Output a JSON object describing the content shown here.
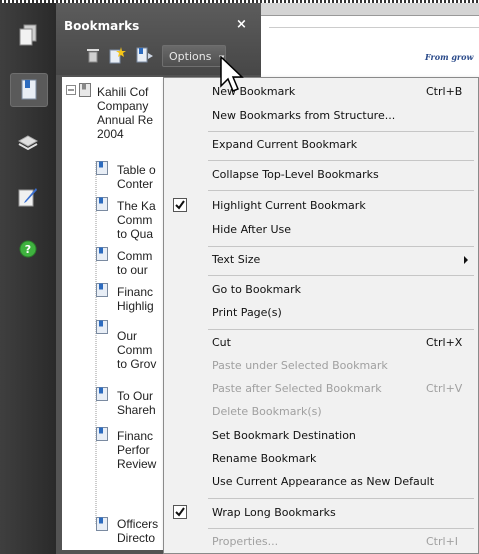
{
  "panel": {
    "title": "Bookmarks",
    "close": "×",
    "options_label": "Options"
  },
  "doc": {
    "header_text": "From grow"
  },
  "tree": {
    "items": [
      "Kahili Cof",
      "Company",
      "Annual Re",
      "2004",
      "Table o",
      "Conter",
      "The Ka",
      "Comm",
      "to Qua",
      "Comm",
      "to our",
      "Financ",
      "Highlig",
      "Our",
      "Comm",
      "to Grov",
      "To Our",
      "Shareh",
      "Financ",
      "Perfor",
      "Review",
      "Officers",
      "Directo"
    ]
  },
  "menu": {
    "items": [
      {
        "label": "New Bookmark",
        "shortcut": "Ctrl+B",
        "disabled": false,
        "checked": false
      },
      {
        "label": "New Bookmarks from Structure...",
        "shortcut": "",
        "disabled": false,
        "checked": false
      },
      {
        "label": "Expand Current Bookmark",
        "shortcut": "",
        "disabled": false,
        "checked": false
      },
      {
        "label": "Collapse Top-Level Bookmarks",
        "shortcut": "",
        "disabled": false,
        "checked": false
      },
      {
        "label": "Highlight Current Bookmark",
        "shortcut": "",
        "disabled": false,
        "checked": true
      },
      {
        "label": "Hide After Use",
        "shortcut": "",
        "disabled": false,
        "checked": false
      },
      {
        "label": "Text Size",
        "shortcut": "",
        "disabled": false,
        "checked": false,
        "submenu": true
      },
      {
        "label": "Go to Bookmark",
        "shortcut": "",
        "disabled": false,
        "checked": false
      },
      {
        "label": "Print Page(s)",
        "shortcut": "",
        "disabled": false,
        "checked": false
      },
      {
        "label": "Cut",
        "shortcut": "Ctrl+X",
        "disabled": false,
        "checked": false
      },
      {
        "label": "Paste under Selected Bookmark",
        "shortcut": "",
        "disabled": true,
        "checked": false
      },
      {
        "label": "Paste after Selected Bookmark",
        "shortcut": "Ctrl+V",
        "disabled": true,
        "checked": false
      },
      {
        "label": "Delete Bookmark(s)",
        "shortcut": "",
        "disabled": true,
        "checked": false
      },
      {
        "label": "Set Bookmark Destination",
        "shortcut": "",
        "disabled": false,
        "checked": false
      },
      {
        "label": "Rename Bookmark",
        "shortcut": "",
        "disabled": false,
        "checked": false
      },
      {
        "label": "Use Current Appearance as New Default",
        "shortcut": "",
        "disabled": false,
        "checked": false
      },
      {
        "label": "Wrap Long Bookmarks",
        "shortcut": "",
        "disabled": false,
        "checked": true
      },
      {
        "label": "Properties...",
        "shortcut": "Ctrl+I",
        "disabled": true,
        "checked": false
      }
    ]
  }
}
